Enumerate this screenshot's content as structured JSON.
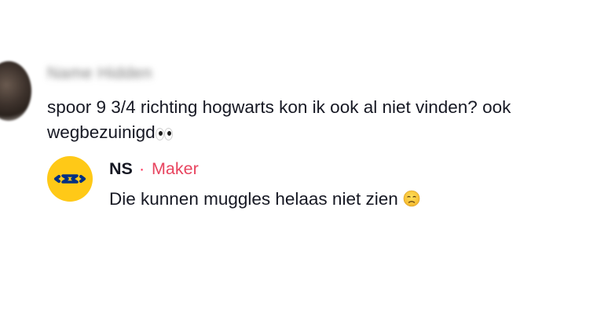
{
  "comment": {
    "author_blurred": "Name Hidden",
    "text": "spoor 9 3/4 richting hogwarts kon ik ook al niet vinden? ook wegbezuinigd",
    "emoji": "eyes-emoji"
  },
  "reply": {
    "author": "NS",
    "separator": "·",
    "badge": "Maker",
    "text": "Die kunnen muggles helaas niet zien",
    "emoji": "disappointed-face-emoji",
    "avatar_icon": "ns-logo-icon"
  },
  "colors": {
    "text": "#161823",
    "badge": "#e8445f",
    "ns_yellow": "#ffc917",
    "ns_blue": "#003082"
  }
}
